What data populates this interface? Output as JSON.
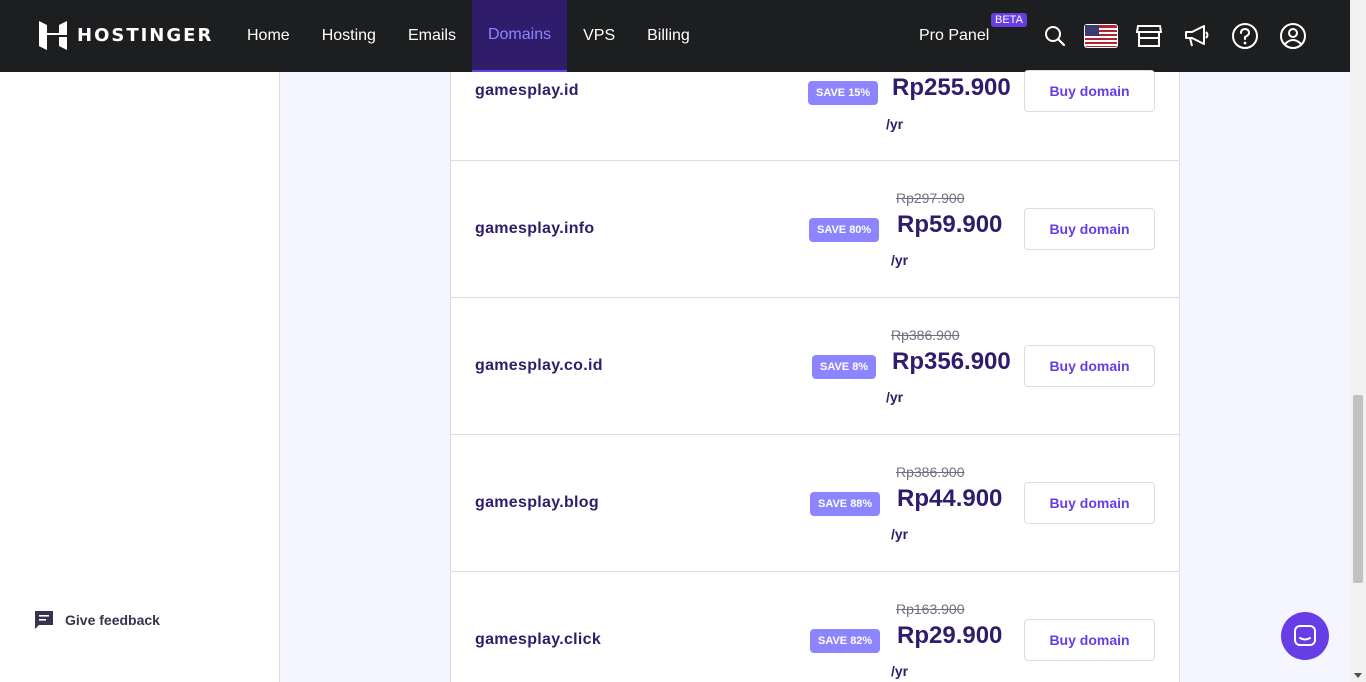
{
  "brand": {
    "name": "HOSTINGER"
  },
  "nav": [
    {
      "label": "Home",
      "active": false
    },
    {
      "label": "Hosting",
      "active": false
    },
    {
      "label": "Emails",
      "active": false
    },
    {
      "label": "Domains",
      "active": true
    },
    {
      "label": "VPS",
      "active": false
    },
    {
      "label": "Billing",
      "active": false
    }
  ],
  "tools": {
    "pro_panel": "Pro Panel",
    "beta": "BETA",
    "icons": [
      "search-icon",
      "us-flag-icon",
      "store-icon",
      "megaphone-icon",
      "help-icon",
      "account-icon"
    ]
  },
  "sidebar": {
    "feedback_label": "Give feedback"
  },
  "domains": [
    {
      "name": "gamesplay.id",
      "save": "SAVE 15%",
      "old_price": "",
      "price": "Rp255.900",
      "per": "/yr",
      "button": "Buy domain"
    },
    {
      "name": "gamesplay.info",
      "save": "SAVE 80%",
      "old_price": "Rp297.900",
      "price": "Rp59.900",
      "per": "/yr",
      "button": "Buy domain"
    },
    {
      "name": "gamesplay.co.id",
      "save": "SAVE 8%",
      "old_price": "Rp386.900",
      "price": "Rp356.900",
      "per": "/yr",
      "button": "Buy domain"
    },
    {
      "name": "gamesplay.blog",
      "save": "SAVE 88%",
      "old_price": "Rp386.900",
      "price": "Rp44.900",
      "per": "/yr",
      "button": "Buy domain"
    },
    {
      "name": "gamesplay.click",
      "save": "SAVE 82%",
      "old_price": "Rp163.900",
      "price": "Rp29.900",
      "per": "/yr",
      "button": "Buy domain"
    }
  ],
  "colors": {
    "accent": "#673de6",
    "dark": "#1d1e20",
    "text": "#2f1c6a",
    "badge": "#8c85ff"
  }
}
